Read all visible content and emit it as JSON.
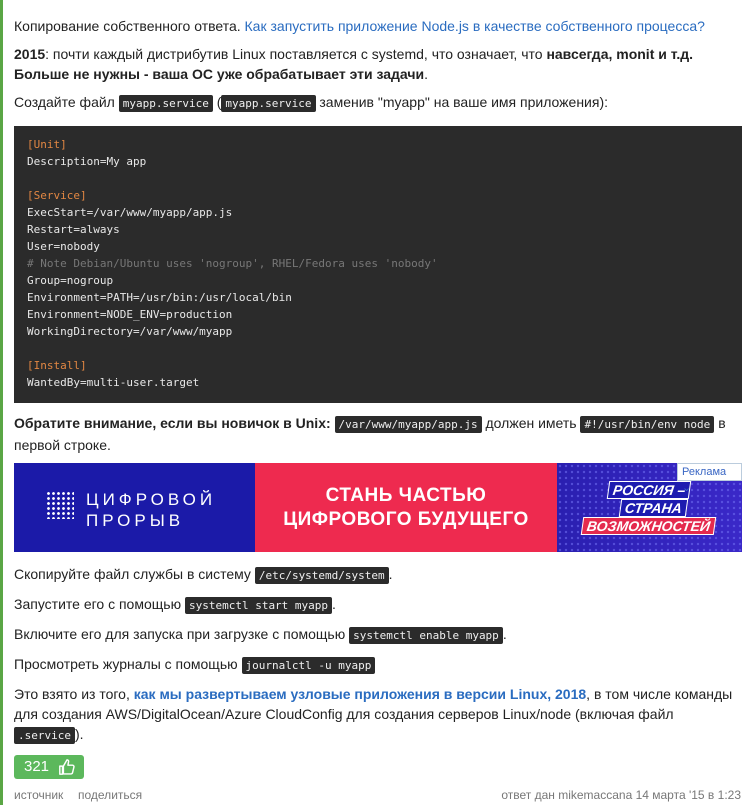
{
  "intro": {
    "prefix": "Копирование собственного ответа.",
    "link": "Как запустить приложение Node.js в качестве собственного процесса?"
  },
  "para2": {
    "year": "2015",
    "text": ": почти каждый дистрибутив Linux поставляется с systemd, что означает, что ",
    "bold": "навсегда, monit и т.д. Больше не нужны - ваша ОС уже обрабатывает эти задачи",
    "end": "."
  },
  "para3": {
    "a": "Создайте файл",
    "code1": "myapp.service",
    "b": "(",
    "code2": "myapp.service",
    "c": "заменив \"myapp\" на ваше имя приложения):"
  },
  "code_lines": [
    {
      "t": "[Unit]",
      "k": "sec"
    },
    {
      "t": "Description=My app",
      "k": ""
    },
    {
      "t": "",
      "k": ""
    },
    {
      "t": "[Service]",
      "k": "sec"
    },
    {
      "t": "ExecStart=/var/www/myapp/app.js",
      "k": ""
    },
    {
      "t": "Restart=always",
      "k": ""
    },
    {
      "t": "User=nobody",
      "k": ""
    },
    {
      "t": "# Note Debian/Ubuntu uses 'nogroup', RHEL/Fedora uses 'nobody'",
      "k": "cm"
    },
    {
      "t": "Group=nogroup",
      "k": ""
    },
    {
      "t": "Environment=PATH=/usr/bin:/usr/local/bin",
      "k": ""
    },
    {
      "t": "Environment=NODE_ENV=production",
      "k": ""
    },
    {
      "t": "WorkingDirectory=/var/www/myapp",
      "k": ""
    },
    {
      "t": "",
      "k": ""
    },
    {
      "t": "[Install]",
      "k": "sec"
    },
    {
      "t": "WantedBy=multi-user.target",
      "k": ""
    }
  ],
  "note": {
    "bold": "Обратите внимание, если вы новичок в Unix:",
    "code1": "/var/www/myapp/app.js",
    "mid": "должен иметь",
    "code2": "#!/usr/bin/env node",
    "end1": "в",
    "end2": "первой строке."
  },
  "ad": {
    "brand1": "ЦИФРОВОЙ",
    "brand2": "ПРОРЫВ",
    "slogan1": "СТАНЬ ЧАСТЬЮ",
    "slogan2": "ЦИФРОВОГО БУДУЩЕГО",
    "tag1": "РОССИЯ –",
    "tag2": "СТРАНА",
    "tag3": "ВОЗМОЖНОСТЕЙ",
    "label": "Реклама ⌄"
  },
  "steps": [
    {
      "text": "Скопируйте файл службы в систему",
      "code": "/etc/systemd/system",
      "end": "."
    },
    {
      "text": "Запустите его с помощью",
      "code": "systemctl start myapp",
      "end": "."
    },
    {
      "text": "Включите его для запуска при загрузке с помощью",
      "code": "systemctl enable myapp",
      "end": "."
    },
    {
      "text": "Просмотреть журналы с помощью",
      "code": "journalctl -u myapp",
      "end": ""
    }
  ],
  "source": {
    "a": "Это взято из того,",
    "link": "как мы развертываем узловые приложения в версии Linux, 2018",
    "b": ", в том числе команды для создания AWS/DigitalOcean/Azure CloudConfig для создания серверов Linux/node (включая файл",
    "code": ".service",
    "c": ")."
  },
  "votes": "321",
  "footer": {
    "source_link": "источник",
    "share_link": "поделиться",
    "answered": "ответ дан mikemaccana 14 марта '15 в 1:23"
  },
  "colors": {
    "accent_green": "#5cb85c",
    "link": "#2a6cc0",
    "code_bg": "#2b2b2b"
  }
}
